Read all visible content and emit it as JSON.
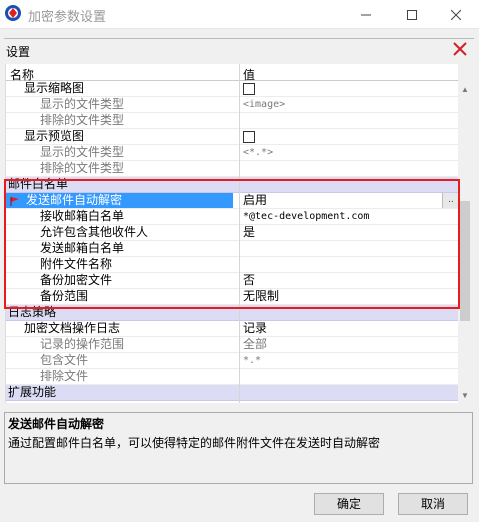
{
  "window": {
    "title": "加密参数设置"
  },
  "panel": {
    "title": "设置"
  },
  "grid": {
    "columns": {
      "name": "名称",
      "value": "值"
    },
    "rows": [
      {
        "name": "显示缩略图",
        "value": "",
        "type": "check",
        "indent": 1,
        "sub": false
      },
      {
        "name": "显示的文件类型",
        "value": "<image>",
        "type": "text",
        "indent": 2,
        "sub": true,
        "mono": true
      },
      {
        "name": "排除的文件类型",
        "value": "",
        "type": "text",
        "indent": 2,
        "sub": true
      },
      {
        "name": "显示预览图",
        "value": "",
        "type": "check",
        "indent": 1,
        "sub": false
      },
      {
        "name": "显示的文件类型",
        "value": "<*.*>",
        "type": "text",
        "indent": 2,
        "sub": true,
        "mono": true
      },
      {
        "name": "排除的文件类型",
        "value": "",
        "type": "text",
        "indent": 2,
        "sub": true
      },
      {
        "name": "邮件白名单",
        "value": "",
        "type": "category"
      },
      {
        "name": "发送邮件自动解密",
        "value": "启用",
        "type": "text",
        "indent": 1,
        "selected": true
      },
      {
        "name": "接收邮箱白名单",
        "value": "*@tec-development.com",
        "type": "text",
        "indent": 2,
        "mono": true
      },
      {
        "name": "允许包含其他收件人",
        "value": "是",
        "type": "text",
        "indent": 2
      },
      {
        "name": "发送邮箱白名单",
        "value": "",
        "type": "text",
        "indent": 2
      },
      {
        "name": "附件文件名称",
        "value": "",
        "type": "text",
        "indent": 2
      },
      {
        "name": "备份加密文件",
        "value": "否",
        "type": "text",
        "indent": 2
      },
      {
        "name": "备份范围",
        "value": "无限制",
        "type": "text",
        "indent": 2
      },
      {
        "name": "日志策略",
        "value": "",
        "type": "category"
      },
      {
        "name": "加密文档操作日志",
        "value": "记录",
        "type": "text",
        "indent": 1
      },
      {
        "name": "记录的操作范围",
        "value": "全部",
        "type": "text",
        "indent": 2,
        "sub": true
      },
      {
        "name": "包含文件",
        "value": "*.*",
        "type": "text",
        "indent": 2,
        "sub": true,
        "mono": true
      },
      {
        "name": "排除文件",
        "value": "",
        "type": "text",
        "indent": 2,
        "sub": true
      },
      {
        "name": "扩展功能",
        "value": "",
        "type": "category"
      }
    ]
  },
  "description": {
    "title": "发送邮件自动解密",
    "text": "通过配置邮件白名单，可以使得特定的邮件附件文件在发送时自动解密"
  },
  "buttons": {
    "ok": "确定",
    "cancel": "取消"
  },
  "colors": {
    "highlight": "#e81c1c",
    "category_bg": "#dcdcf4",
    "selection": "#3399ff"
  }
}
